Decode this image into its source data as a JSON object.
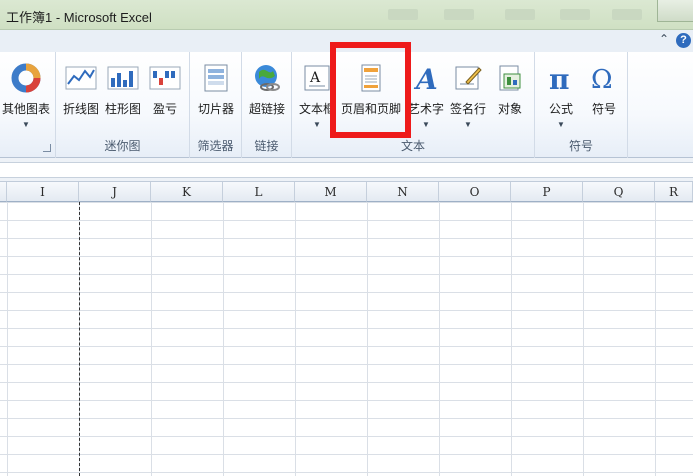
{
  "window": {
    "title": "工作簿1 - Microsoft Excel",
    "help_glyph": "?",
    "minimize_glyph": "⌃"
  },
  "ribbon": {
    "groups": {
      "charts": {
        "other_charts": "其他图表"
      },
      "sparklines": {
        "label": "迷你图",
        "line": "折线图",
        "column": "柱形图",
        "win_loss": "盈亏"
      },
      "filter": {
        "label": "筛选器",
        "slicer": "切片器"
      },
      "links": {
        "label": "链接",
        "hyperlink": "超链接"
      },
      "text": {
        "label": "文本",
        "textbox": "文本框",
        "header_footer": "页眉和页脚",
        "wordart": "艺术字",
        "signature_line": "签名行",
        "object": "对象"
      },
      "symbols": {
        "label": "符号",
        "equation": "公式",
        "symbol": "符号"
      }
    },
    "arrow_glyph": "▼"
  },
  "grid": {
    "columns": [
      "I",
      "J",
      "K",
      "L",
      "M",
      "N",
      "O",
      "P",
      "Q",
      "R"
    ]
  }
}
